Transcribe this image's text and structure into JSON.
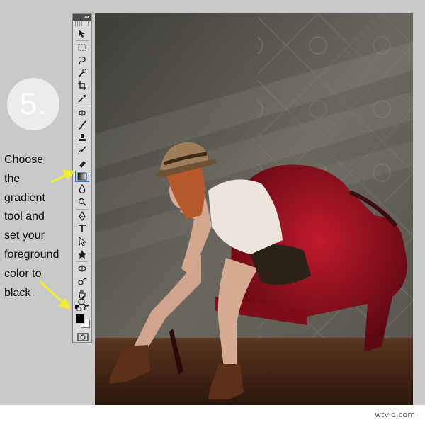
{
  "step": {
    "number": "5."
  },
  "instructions": {
    "lines": [
      "Choose",
      "the",
      "gradient",
      "tool and",
      "set your",
      "foreground",
      "color to",
      "black"
    ]
  },
  "toolbox": {
    "selected_tool": "gradient-tool",
    "foreground_color": "#000000",
    "background_color": "#ffffff",
    "tools": [
      "move-tool",
      "marquee-tool",
      "lasso-tool",
      "quick-selection-tool",
      "crop-tool",
      "eyedropper-tool",
      "spot-healing-tool",
      "brush-tool",
      "clone-stamp-tool",
      "history-brush-tool",
      "eraser-tool",
      "gradient-tool",
      "blur-tool",
      "dodge-tool",
      "pen-tool",
      "type-tool",
      "path-selection-tool",
      "custom-shape-tool",
      "3d-rotate-tool",
      "3d-orbit-tool",
      "hand-tool",
      "zoom-tool"
    ]
  },
  "colors": {
    "arrow": "#f2ee2a",
    "chair": "#9e0f1e",
    "wall": "#5e5c55",
    "floor": "#4b2a17"
  },
  "watermark": {
    "text": "wtvid.com"
  }
}
